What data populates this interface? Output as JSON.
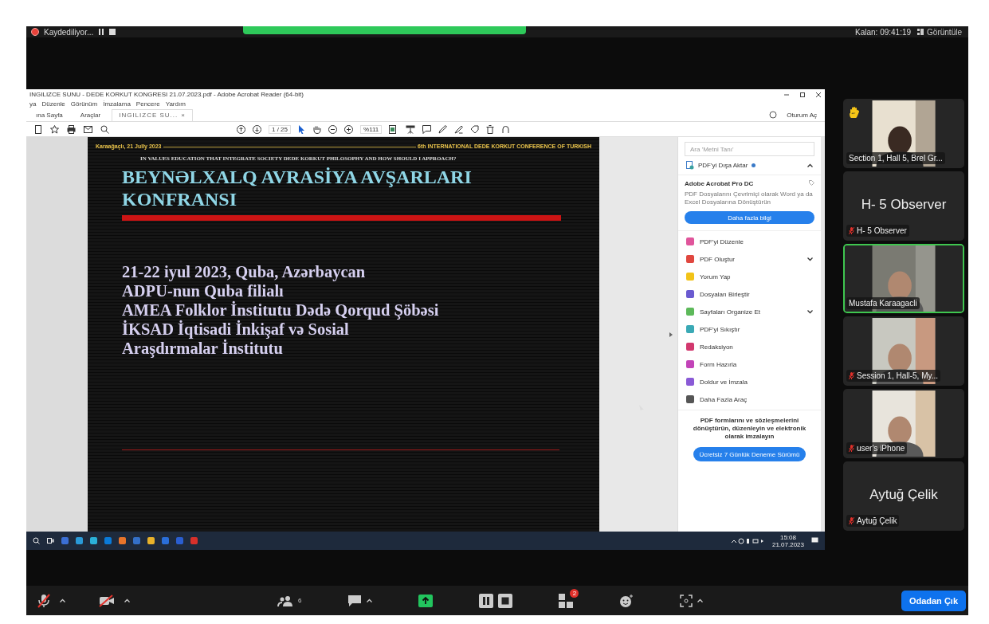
{
  "top_bar": {
    "recording": "Kaydediliyor...",
    "remaining": "Kalan: 09:41:19",
    "view": "Görüntüle"
  },
  "acrobat": {
    "title": "INGILIZCE SUNU - DEDE KORKUT KONGRESI 21.07.2023.pdf - Adobe Acrobat Reader (64-bit)",
    "menu": [
      "ya",
      "Düzenle",
      "Görünüm",
      "İmzalama",
      "Pencere",
      "Yardım"
    ],
    "tabs": [
      {
        "label": "ına Sayfa",
        "selected": false
      },
      {
        "label": "Araçlar",
        "selected": false
      },
      {
        "label": "INGILIZCE SU...",
        "selected": true,
        "close": "×"
      }
    ],
    "sign_in": "Oturum Aç",
    "page": "1 / 25",
    "zoom": "%111",
    "slide": {
      "header_left": "Karaağaçlı, 21 Jully  2023",
      "header_right": "6th INTERNATIONAL DEDE KORKUT CONFERENCE  OF TURKISH",
      "subtitle": "IN VALUES   EDUCATION THAT INTEGRATE SOCIETY DEDE KORKUT PHILOSOPHY AND HOW SHOULD I APPROACH?",
      "title": [
        "BEYNƏLXALQ AVRASİYA AVŞARLARI",
        "KONFRANSI"
      ],
      "lines": [
        "21-22 iyul 2023, Quba, Azərbaycan",
        "ADPU-nun Quba filialı",
        "AMEA Folklor İnstitutu Dədə Qorqud Şöbəsi",
        "İKSAD İqtisadi İnkişaf və Sosial",
        "Araşdırmalar İnstitutu"
      ]
    },
    "panel": {
      "search_placeholder": "Ara 'Metni Tanı'",
      "export": "PDF'yi Dışa Aktar",
      "promo_title": "Adobe Acrobat Pro DC",
      "promo_text": "PDF Dosyalarını Çevrimiçi olarak Word ya da Excel Dosyalarına Dönüştürün",
      "promo_button": "Daha fazla bilgi",
      "tools": [
        {
          "label": "PDF'yi Düzenle",
          "color": "#e0559b",
          "expandable": false
        },
        {
          "label": "PDF Oluştur",
          "color": "#e0473f",
          "expandable": true
        },
        {
          "label": "Yorum Yap",
          "color": "#f2c318",
          "expandable": false
        },
        {
          "label": "Dosyaları Birleştir",
          "color": "#6a5ad0",
          "expandable": false
        },
        {
          "label": "Sayfaları Organize Et",
          "color": "#5db95a",
          "expandable": true
        },
        {
          "label": "PDF'yi Sıkıştır",
          "color": "#3aa9b5",
          "expandable": false
        },
        {
          "label": "Redaksiyon",
          "color": "#d2386e",
          "expandable": false
        },
        {
          "label": "Form Hazırla",
          "color": "#c243b8",
          "expandable": false
        },
        {
          "label": "Doldur ve İmzala",
          "color": "#8a5ad6",
          "expandable": false
        },
        {
          "label": "Daha Fazla Araç",
          "color": "#555555",
          "expandable": false
        }
      ],
      "footer": "PDF formlarını ve sözleşmelerini dönüştürün, düzenleyin ve elektronik olarak imzalayın",
      "trial": "Ücretsiz 7 Günlük Deneme Sürümü"
    }
  },
  "taskbar": {
    "time": "15:08",
    "date": "21.07.2023"
  },
  "participants": [
    {
      "kind": "video",
      "name": "Section 1, Hall 5, Brel Gr...",
      "muted": false,
      "hand_raised": true,
      "speaking": false
    },
    {
      "kind": "name",
      "big": "H- 5 Observer",
      "name": "H- 5 Observer",
      "muted": true,
      "hand_raised": false,
      "speaking": false
    },
    {
      "kind": "video",
      "name": "Mustafa Karaagacli",
      "muted": false,
      "hand_raised": false,
      "speaking": true
    },
    {
      "kind": "video",
      "name": "Session 1, Hall-5, My...",
      "muted": true,
      "hand_raised": false,
      "speaking": false
    },
    {
      "kind": "video",
      "name": "user's iPhone",
      "muted": true,
      "hand_raised": false,
      "speaking": false
    },
    {
      "kind": "name",
      "big": "Aytuğ Çelik",
      "name": "Aytuğ Çelik",
      "muted": true,
      "hand_raised": false,
      "speaking": false
    }
  ],
  "toolbar": {
    "mic_muted": true,
    "video_off": true,
    "participants_count": "6",
    "apps_badge": "2",
    "leave": "Odadan Çık"
  }
}
